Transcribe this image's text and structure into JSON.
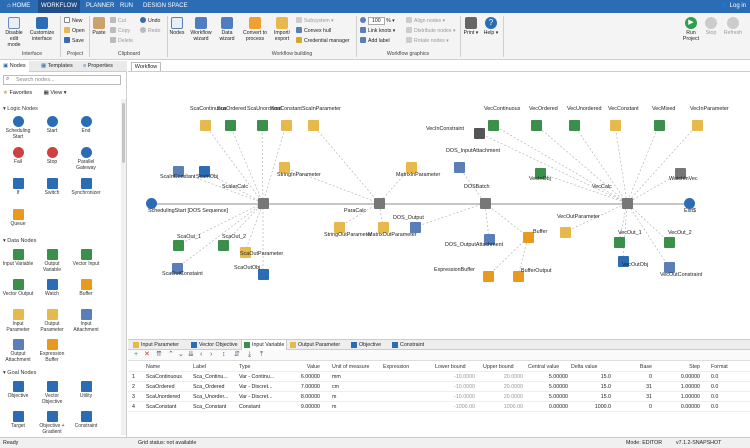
{
  "topbar": {
    "tabs": [
      "HOME",
      "WORKFLOW",
      "PLANNER",
      "RUN",
      "DESIGN SPACE"
    ],
    "login": "Log in"
  },
  "ribbon": {
    "disable_edit": "Disable edit mode",
    "customize": "Customize interface",
    "interface_group": "Interface",
    "new": "New",
    "open": "Open",
    "save": "Save",
    "project_group": "Project",
    "paste": "Paste",
    "cut": "Cut",
    "copy": "Copy",
    "delete": "Delete",
    "undo": "Undo",
    "redo": "Redo",
    "clipboard_group": "Clipboard",
    "nodes": "Nodes",
    "workflow_wizard": "Workflow wizard",
    "data_wizard": "Data wizard",
    "convert": "Convert to process",
    "import_export": "Import/ export",
    "subsystem": "Subsystem",
    "convex_hull": "Convex hull",
    "credential_manager": "Credential manager",
    "building_group": "Workflow building",
    "zoom": "100",
    "zoom_unit": "%",
    "link_knots": "Link knots",
    "add_label": "Add label",
    "align_nodes": "Align nodes",
    "distribute_nodes": "Distribute nodes",
    "rotate_nodes": "Rotate nodes",
    "graphics_group": "Workflow graphics",
    "print": "Print",
    "help": "Help",
    "run_project": "Run Project",
    "stop": "Stop",
    "refresh": "Refresh"
  },
  "left": {
    "tabs": [
      "Nodes",
      "Templates",
      "Properties"
    ],
    "search_placeholder": "Search nodes...",
    "favorites": "Favorites",
    "view": "View",
    "sections": [
      "Logic Nodes",
      "Data Nodes",
      "Goal Nodes"
    ],
    "logic_nodes": [
      "Scheduling Start",
      "Start",
      "End",
      "Fail",
      "Stop",
      "Parallel Gateway",
      "If",
      "Switch",
      "Synchronizer",
      "Queue"
    ],
    "data_nodes": [
      "Input Variable",
      "Output Variable",
      "Vector Input",
      "Vector Output",
      "Watch",
      "Buffer",
      "Input Parameter",
      "Output Parameter",
      "Input Attachment",
      "Output Attachment",
      "Expression Buffer"
    ],
    "goal_nodes": [
      "Objective",
      "Vector Objective",
      "Utility",
      "Target",
      "Objective + Gradient",
      "Constraint"
    ]
  },
  "workflow_tab": "Workflow",
  "canvas": {
    "labels": [
      "ScaContinuous",
      "ScaOrdered",
      "ScaUnordered",
      "ScaConstant",
      "ScaInParameter",
      "ScaInConstant",
      "ScaInObj",
      "ScalarCalc",
      "StringInParameter",
      "MatrixInParameter",
      "SchedulingStart [DOS Sequence]",
      "ParaCalc",
      "DOS_InputAttachment",
      "DOSBatch",
      "VecInObj",
      "VecCalc",
      "WatchInVec",
      "Exit$",
      "ScaOut_1",
      "ScaOut_2",
      "ScaOutParameter",
      "StringOutParameter",
      "MatrixOutParameter",
      "DOS_Output",
      "DOS_OutputAttachment",
      "Buffer",
      "ExpressionBuffer",
      "BufferOutput",
      "ScaOutConstaint",
      "ScaOutObj",
      "VecInConstraint",
      "VecContinuous",
      "VecOrdered",
      "VecUnordered",
      "VecConstant",
      "VecMixed",
      "VecInParameter",
      "VecOutParameter",
      "VecOut_1",
      "VecOut_2",
      "VecOutObj",
      "VecOutConstraint"
    ]
  },
  "bottom_tabs": [
    "Input Parameter",
    "Vector Objective",
    "Input Variable",
    "Output Parameter",
    "Objective",
    "Constraint"
  ],
  "table": {
    "headers": [
      "Name",
      "Label",
      "Type",
      "Value",
      "Unit of measure",
      "Expression",
      "Lower bound",
      "Upper bound",
      "Central value",
      "Delta value",
      "Base",
      "Step",
      "Format"
    ],
    "rows": [
      [
        "1",
        "ScaContinuous",
        "Sca_Continu...",
        "Var - Continu...",
        "6.00000",
        "mm",
        "",
        "-10.0000",
        "20.0000",
        "5.00000",
        "15.0",
        "0",
        "0.00000",
        "0.0"
      ],
      [
        "2",
        "ScaOrdered",
        "Sca_Ordered",
        "Var - Discret...",
        "7.00000",
        "cm",
        "",
        "-10.0000",
        "20.0000",
        "5.00000",
        "15.0",
        "31",
        "1.00000",
        "0.0"
      ],
      [
        "3",
        "ScaUnordered",
        "Sca_Unorder...",
        "Var - Discret...",
        "8.00000",
        "m",
        "",
        "-10.0000",
        "20.0000",
        "5.00000",
        "15.0",
        "31",
        "1.00000",
        "0.0"
      ],
      [
        "4",
        "ScaConstant",
        "Sca_Constant",
        "Constant",
        "9.00000",
        "m",
        "",
        "-1000.00",
        "1000.00",
        "0.00000",
        "1000.0",
        "0",
        "0.00000",
        "0.0"
      ]
    ]
  },
  "status": {
    "left": "Ready",
    "grid": "Grid status: not available",
    "mode": "Mode: EDITOR",
    "version": "v7.1.2-SNAPSHOT 8202103072"
  }
}
